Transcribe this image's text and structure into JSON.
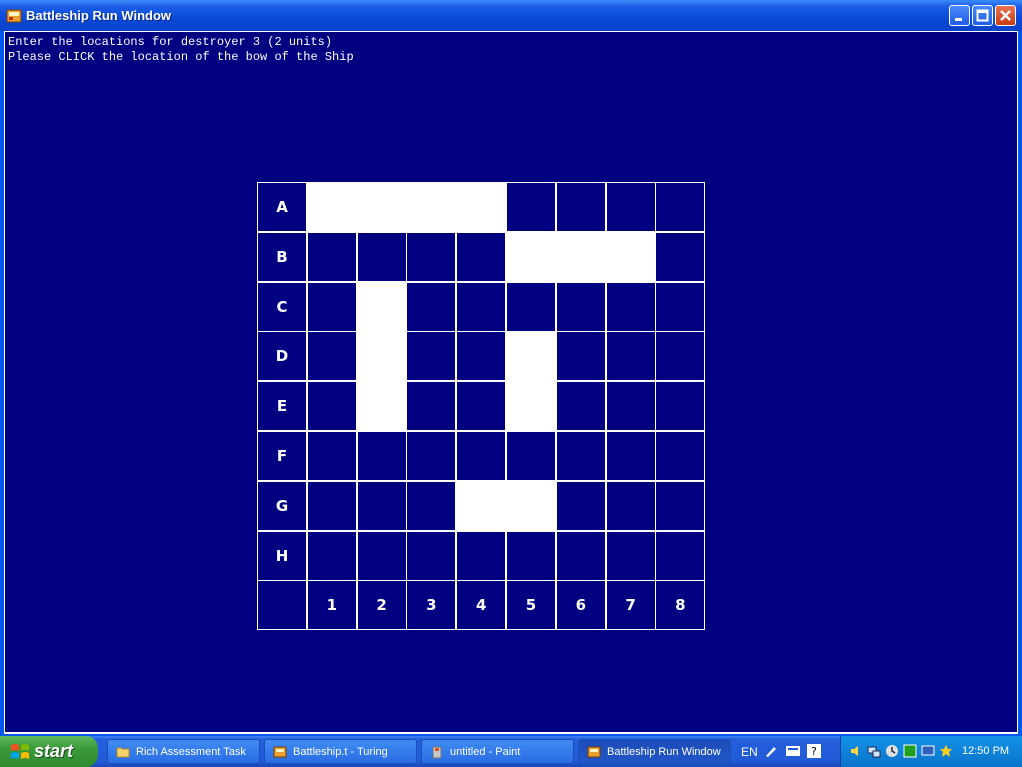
{
  "window": {
    "title": "Battleship Run Window"
  },
  "console": {
    "line1": "Enter the locations for destroyer 3 (2 units)",
    "line2": "Please CLICK the location of the bow of the Ship"
  },
  "board": {
    "rows": [
      "A",
      "B",
      "C",
      "D",
      "E",
      "F",
      "G",
      "H"
    ],
    "cols": [
      "1",
      "2",
      "3",
      "4",
      "5",
      "6",
      "7",
      "8"
    ],
    "ship_cells": [
      "A1",
      "A2",
      "A3",
      "A4",
      "B5",
      "B6",
      "B7",
      "C2",
      "D2",
      "E2",
      "D5",
      "E5",
      "G4",
      "G5"
    ]
  },
  "taskbar": {
    "start_label": "start",
    "tasks": [
      {
        "label": "Rich Assessment Task",
        "icon": "folder-icon"
      },
      {
        "label": "Battleship.t - Turing",
        "icon": "turing-icon"
      },
      {
        "label": "untitled - Paint",
        "icon": "paint-icon"
      },
      {
        "label": "Battleship Run Window",
        "icon": "turing-icon",
        "active": true
      }
    ],
    "language": "EN",
    "clock": "12:50 PM"
  },
  "colors": {
    "background": "#000080",
    "ship": "#ffffff"
  }
}
